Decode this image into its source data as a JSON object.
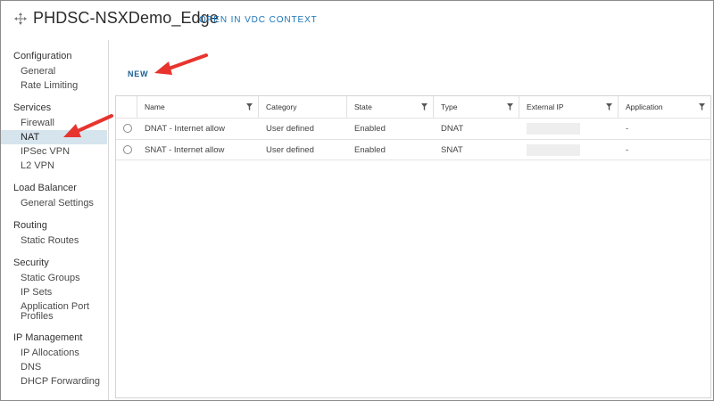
{
  "header": {
    "title": "PHDSC-NSXDemo_Edge",
    "open_vdc_label": "OPEN IN VDC CONTEXT",
    "icon": "edge-gateway-icon"
  },
  "sidebar": {
    "groups": [
      {
        "title": "Configuration",
        "items": [
          "General",
          "Rate Limiting"
        ]
      },
      {
        "title": "Services",
        "items": [
          "Firewall",
          "NAT",
          "IPSec VPN",
          "L2 VPN"
        ]
      },
      {
        "title": "Load Balancer",
        "items": [
          "General Settings"
        ]
      },
      {
        "title": "Routing",
        "items": [
          "Static Routes"
        ]
      },
      {
        "title": "Security",
        "items": [
          "Static Groups",
          "IP Sets",
          "Application Port",
          "Profiles"
        ]
      },
      {
        "title": "IP Management",
        "items": [
          "IP Allocations",
          "DNS",
          "DHCP Forwarding"
        ]
      }
    ],
    "selected_item": "NAT"
  },
  "toolbar": {
    "new_label": "NEW"
  },
  "grid": {
    "columns": [
      "Name",
      "Category",
      "State",
      "Type",
      "External IP",
      "Application"
    ],
    "rows": [
      {
        "name": "DNAT - Internet allow",
        "category": "User defined",
        "state": "Enabled",
        "type": "DNAT",
        "external_ip": "",
        "application": "-"
      },
      {
        "name": "SNAT - Internet allow",
        "category": "User defined",
        "state": "Enabled",
        "type": "SNAT",
        "external_ip": "",
        "application": "-"
      }
    ]
  },
  "colors": {
    "accent": "#1a74b8",
    "selected_bg": "#d6e4ee",
    "arrow": "#e8342f"
  }
}
